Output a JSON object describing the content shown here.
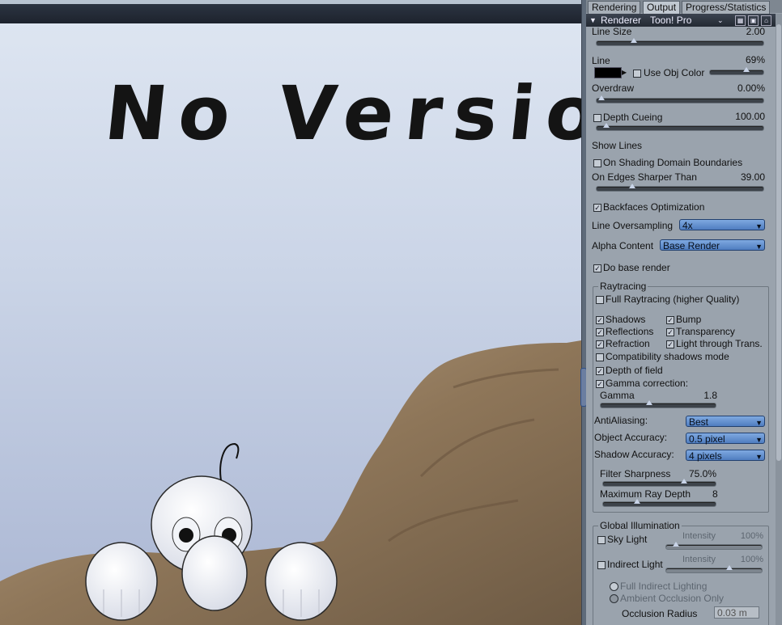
{
  "canvas_text": "No Version",
  "tabs": [
    "Rendering",
    "Output",
    "Progress/Statistics"
  ],
  "renderer": {
    "label": "Renderer",
    "value": "Toon! Pro"
  },
  "line_size": {
    "label": "Line Size",
    "value": "2.00",
    "level": 0.28
  },
  "line": {
    "label": "Line",
    "value": "69%",
    "use_obj_color": "Use Obj Color",
    "color": "#000000",
    "level": 0.69
  },
  "overdraw": {
    "label": "Overdraw",
    "value": "0.00%",
    "level": 0.0
  },
  "depth_cueing": {
    "label": "Depth Cueing",
    "value": "100.00",
    "level": 0.03
  },
  "show_lines": {
    "label": "Show Lines",
    "on_shading": "On Shading Domain Boundaries",
    "on_edges": "On Edges Sharper Than",
    "edges_value": "39.00",
    "level": 0.2
  },
  "backfaces": "Backfaces Optimization",
  "line_oversampling": {
    "label": "Line Oversampling",
    "value": "4x"
  },
  "alpha_content": {
    "label": "Alpha Content",
    "value": "Base Render"
  },
  "do_base_render": "Do base render",
  "raytracing": {
    "title": "Raytracing",
    "full": "Full Raytracing (higher Quality)",
    "shadows": "Shadows",
    "bump": "Bump",
    "reflections": "Reflections",
    "transparency": "Transparency",
    "refraction": "Refraction",
    "light_through": "Light through Trans.",
    "compat": "Compatibility shadows mode",
    "dof": "Depth of field",
    "gamma_corr": "Gamma correction:",
    "gamma_label": "Gamma",
    "gamma_value": "1.8",
    "gamma_level": 0.4
  },
  "antialiasing": {
    "label": "AntiAliasing:",
    "value": "Best"
  },
  "object_accuracy": {
    "label": "Object Accuracy:",
    "value": "0.5 pixel"
  },
  "shadow_accuracy": {
    "label": "Shadow Accuracy:",
    "value": "4 pixels"
  },
  "filter_sharpness": {
    "label": "Filter Sharpness",
    "value": "75.0%",
    "level": 0.75
  },
  "max_ray_depth": {
    "label": "Maximum Ray Depth",
    "value": "8",
    "level": 0.3
  },
  "gi": {
    "title": "Global Illumination",
    "sky_light": "Sky Light",
    "intensity": "Intensity",
    "sky_value": "100%",
    "indirect_light": "Indirect Light",
    "indirect_value": "100%",
    "full_indirect": "Full Indirect Lighting",
    "ambient_occlusion": "Ambient Occlusion Only",
    "occlusion_radius": "Occlusion Radius",
    "radius_value": "0.03 m"
  }
}
